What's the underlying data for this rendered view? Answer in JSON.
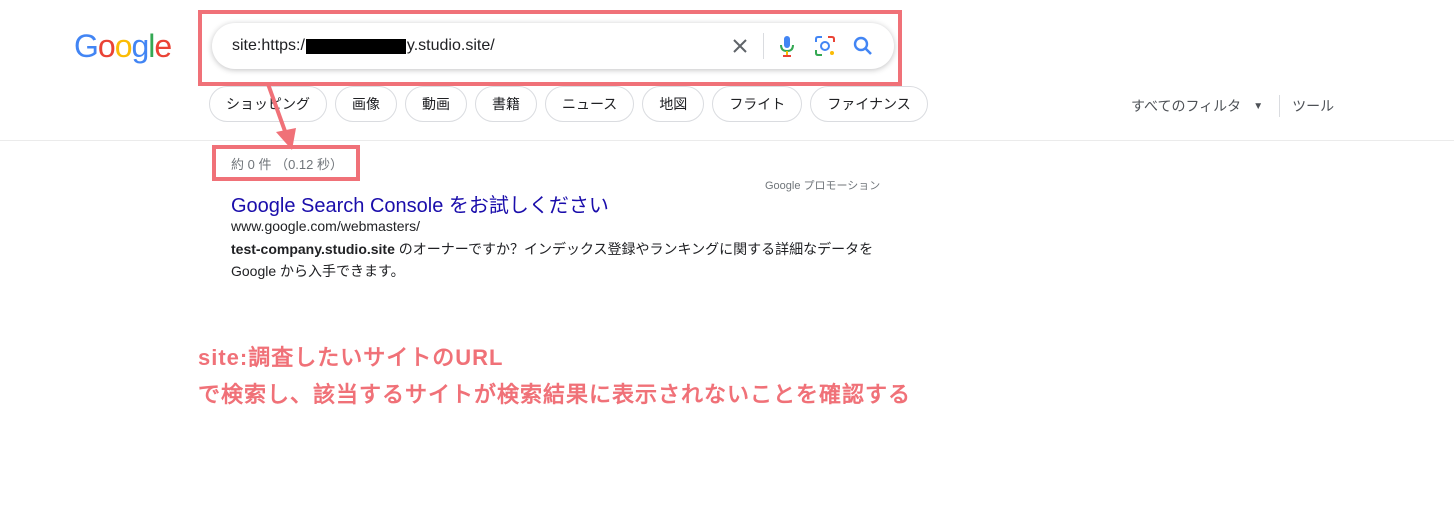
{
  "logo": {
    "letters": [
      "G",
      "o",
      "o",
      "g",
      "l",
      "e"
    ],
    "colors": [
      "#4285F4",
      "#EA4335",
      "#FBBC05",
      "#4285F4",
      "#34A853",
      "#EA4335"
    ]
  },
  "search": {
    "query_prefix": "site:https:/",
    "query_suffix": "y.studio.site/"
  },
  "chips": [
    "ショッピング",
    "画像",
    "動画",
    "書籍",
    "ニュース",
    "地図",
    "フライト",
    "ファイナンス"
  ],
  "filters": {
    "all_filters": "すべてのフィルタ",
    "tools": "ツール"
  },
  "results": {
    "count": "約 0 件 （0.12 秒）"
  },
  "ad": {
    "label": "Google プロモーション",
    "title": "Google Search Console をお試しください",
    "url": "www.google.com/webmasters/",
    "desc_bold": "test-company.studio.site",
    "desc_line1": " のオーナーですか？インデックス登録やランキングに関する詳細なデータを",
    "desc_line2": "Google から入手できます。"
  },
  "annotation": {
    "line1": "site:調査したいサイトのURL",
    "line2": "で検索し、該当するサイトが検索結果に表示されないことを確認する",
    "color": "#f07178"
  }
}
